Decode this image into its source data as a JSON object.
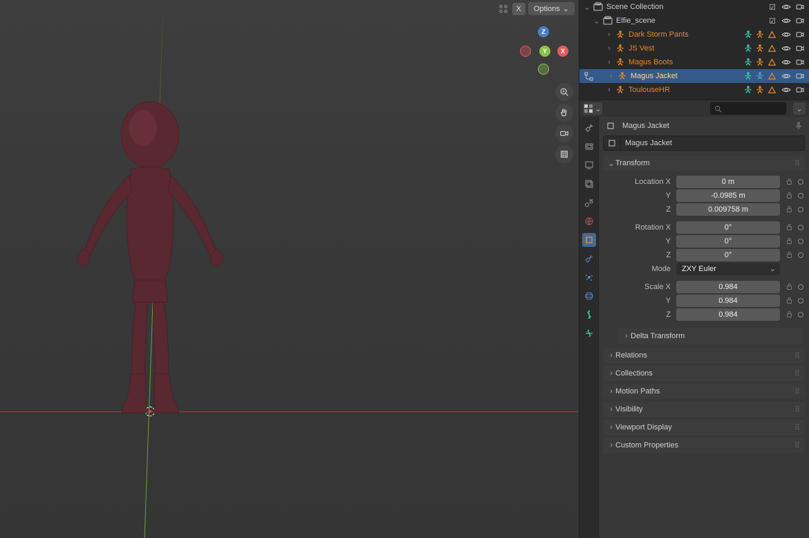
{
  "viewport": {
    "header": {
      "options_label": "Options",
      "x_label": "X"
    },
    "gizmo": {
      "x": "X",
      "y": "Y",
      "z": "Z"
    }
  },
  "outliner": {
    "root": "Scene Collection",
    "scene": "Elfie_scene",
    "items": [
      {
        "name": "Dark Storm Pants"
      },
      {
        "name": "JS Vest"
      },
      {
        "name": "Magus Boots"
      },
      {
        "name": "Magus Jacket"
      },
      {
        "name": "ToulouseHR"
      }
    ]
  },
  "properties": {
    "search_placeholder": "",
    "breadcrumb": "Magus Jacket",
    "object_name": "Magus Jacket",
    "transform": {
      "title": "Transform",
      "location": {
        "label": "Location X",
        "x": "0 m",
        "y": "-0.0985 m",
        "z": "0.009758 m",
        "yl": "Y",
        "zl": "Z"
      },
      "rotation": {
        "label": "Rotation X",
        "x": "0°",
        "y": "0°",
        "z": "0°",
        "yl": "Y",
        "zl": "Z"
      },
      "mode": {
        "label": "Mode",
        "value": "ZXY Euler"
      },
      "scale": {
        "label": "Scale X",
        "x": "0.984",
        "y": "0.984",
        "z": "0.984",
        "yl": "Y",
        "zl": "Z"
      },
      "delta": "Delta Transform"
    },
    "panels": [
      "Relations",
      "Collections",
      "Motion Paths",
      "Visibility",
      "Viewport Display",
      "Custom Properties"
    ]
  }
}
